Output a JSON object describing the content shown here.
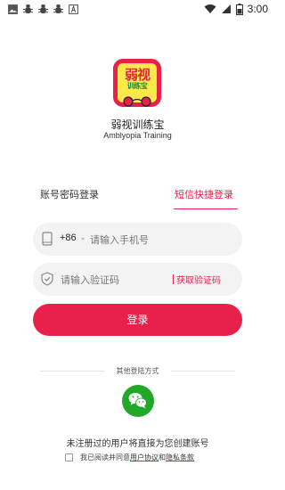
{
  "status_bar": {
    "time": "3:00",
    "left_icons": [
      "image-icon",
      "bug-icon",
      "bug-icon",
      "bug-icon",
      "text-a-icon"
    ],
    "right_icons": [
      "wifi-icon",
      "signal-icon",
      "battery-icon"
    ]
  },
  "app": {
    "logo_text_top": "弱视",
    "logo_text_bottom": "训练宝",
    "title": "弱视训练宝",
    "subtitle": "Amblyopia Training"
  },
  "tabs": {
    "account_login": "账号密码登录",
    "sms_login": "短信快捷登录",
    "active": "sms_login"
  },
  "phone": {
    "country_code": "+86",
    "placeholder": "请输入手机号",
    "value": ""
  },
  "code": {
    "placeholder": "请输入验证码",
    "value": "",
    "get_code_label": "获取验证码"
  },
  "login_button": "登录",
  "other_login": {
    "label": "其他登陆方式",
    "methods": [
      "wechat-icon"
    ]
  },
  "hint": "未注册过的用户将直接为您创建账号",
  "agreement": {
    "prefix": "我已阅读并同意",
    "user_agreement": "用户协议",
    "and": "和",
    "privacy": "隐私条款",
    "checked": false
  },
  "colors": {
    "accent": "#e8204a",
    "wechat": "#22a829",
    "field_bg": "#f3f3f3"
  }
}
